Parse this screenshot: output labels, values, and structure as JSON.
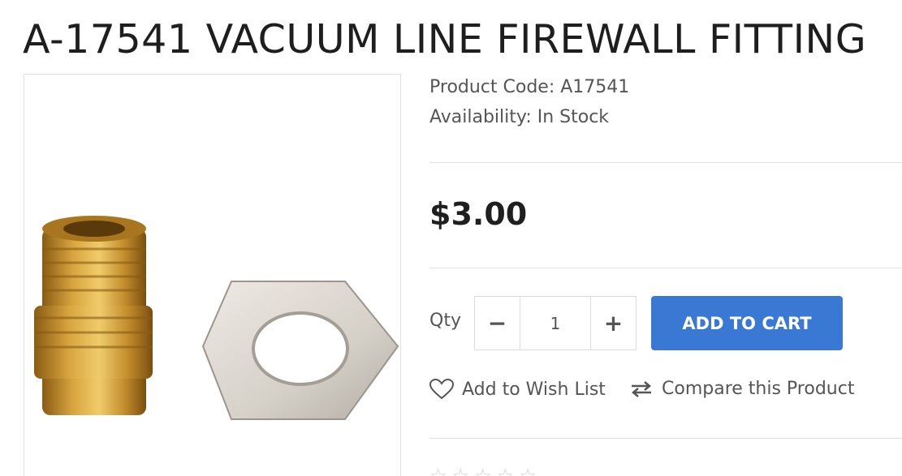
{
  "product": {
    "title": "A-17541 VACUUM LINE FIREWALL FITTING",
    "code_line": "Product Code: A17541",
    "availability_line": "Availability: In Stock",
    "price": "$3.00"
  },
  "purchase": {
    "qty_label": "Qty",
    "qty_value": "1",
    "minus_label": "−",
    "plus_label": "+",
    "add_to_cart_label": "ADD TO CART"
  },
  "actions": {
    "wish_list_label": "Add to Wish List",
    "compare_label": "Compare this Product",
    "wish_icon": "heart-icon",
    "compare_icon": "compare-arrows-icon"
  },
  "colors": {
    "accent": "#3a79d3",
    "brass": "#c8962f",
    "nut_silver": "#d8d3cc"
  }
}
